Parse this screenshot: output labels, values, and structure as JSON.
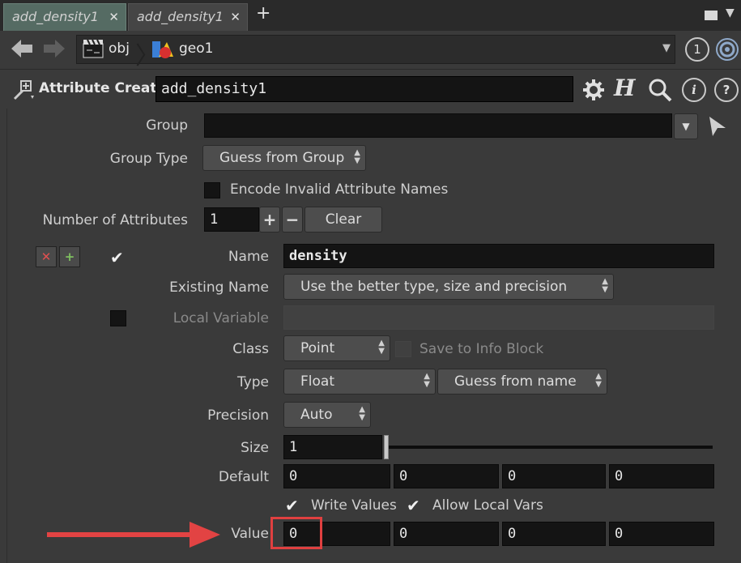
{
  "tabs": [
    {
      "label": "add_density1",
      "close": "✕"
    },
    {
      "label": "add_density1",
      "close": "✕"
    }
  ],
  "new_tab": "+",
  "path": {
    "obj": "obj",
    "geo": "geo1",
    "badge": "1"
  },
  "node": {
    "type_label": "Attribute Create",
    "name": "add_density1"
  },
  "params": {
    "group_label": "Group",
    "group_value": "",
    "group_type_label": "Group Type",
    "group_type_value": "Guess from Group",
    "encode_label": "Encode Invalid Attribute Names",
    "num_attrs_label": "Number of Attributes",
    "num_attrs_value": "1",
    "plus": "+",
    "minus": "−",
    "clear_label": "Clear",
    "name_label": "Name",
    "name_value": "density",
    "existing_name_label": "Existing Name",
    "existing_name_value": "Use the better type, size and precision",
    "local_var_label": "Local Variable",
    "class_label": "Class",
    "class_value": "Point",
    "save_info_label": "Save to Info Block",
    "type_label": "Type",
    "type_value": "Float",
    "type_guess_value": "Guess from name",
    "precision_label": "Precision",
    "precision_value": "Auto",
    "size_label": "Size",
    "size_value": "1",
    "default_label": "Default",
    "default_values": [
      "0",
      "0",
      "0",
      "0"
    ],
    "write_values_label": "Write Values",
    "allow_local_label": "Allow Local Vars",
    "value_label": "Value",
    "value_values": [
      "0",
      "0",
      "0",
      "0"
    ]
  },
  "icons": {
    "delete": "✕",
    "add": "+",
    "check": "✔"
  },
  "colors": {
    "highlight": "#e04040",
    "arrow": "#e24343"
  }
}
